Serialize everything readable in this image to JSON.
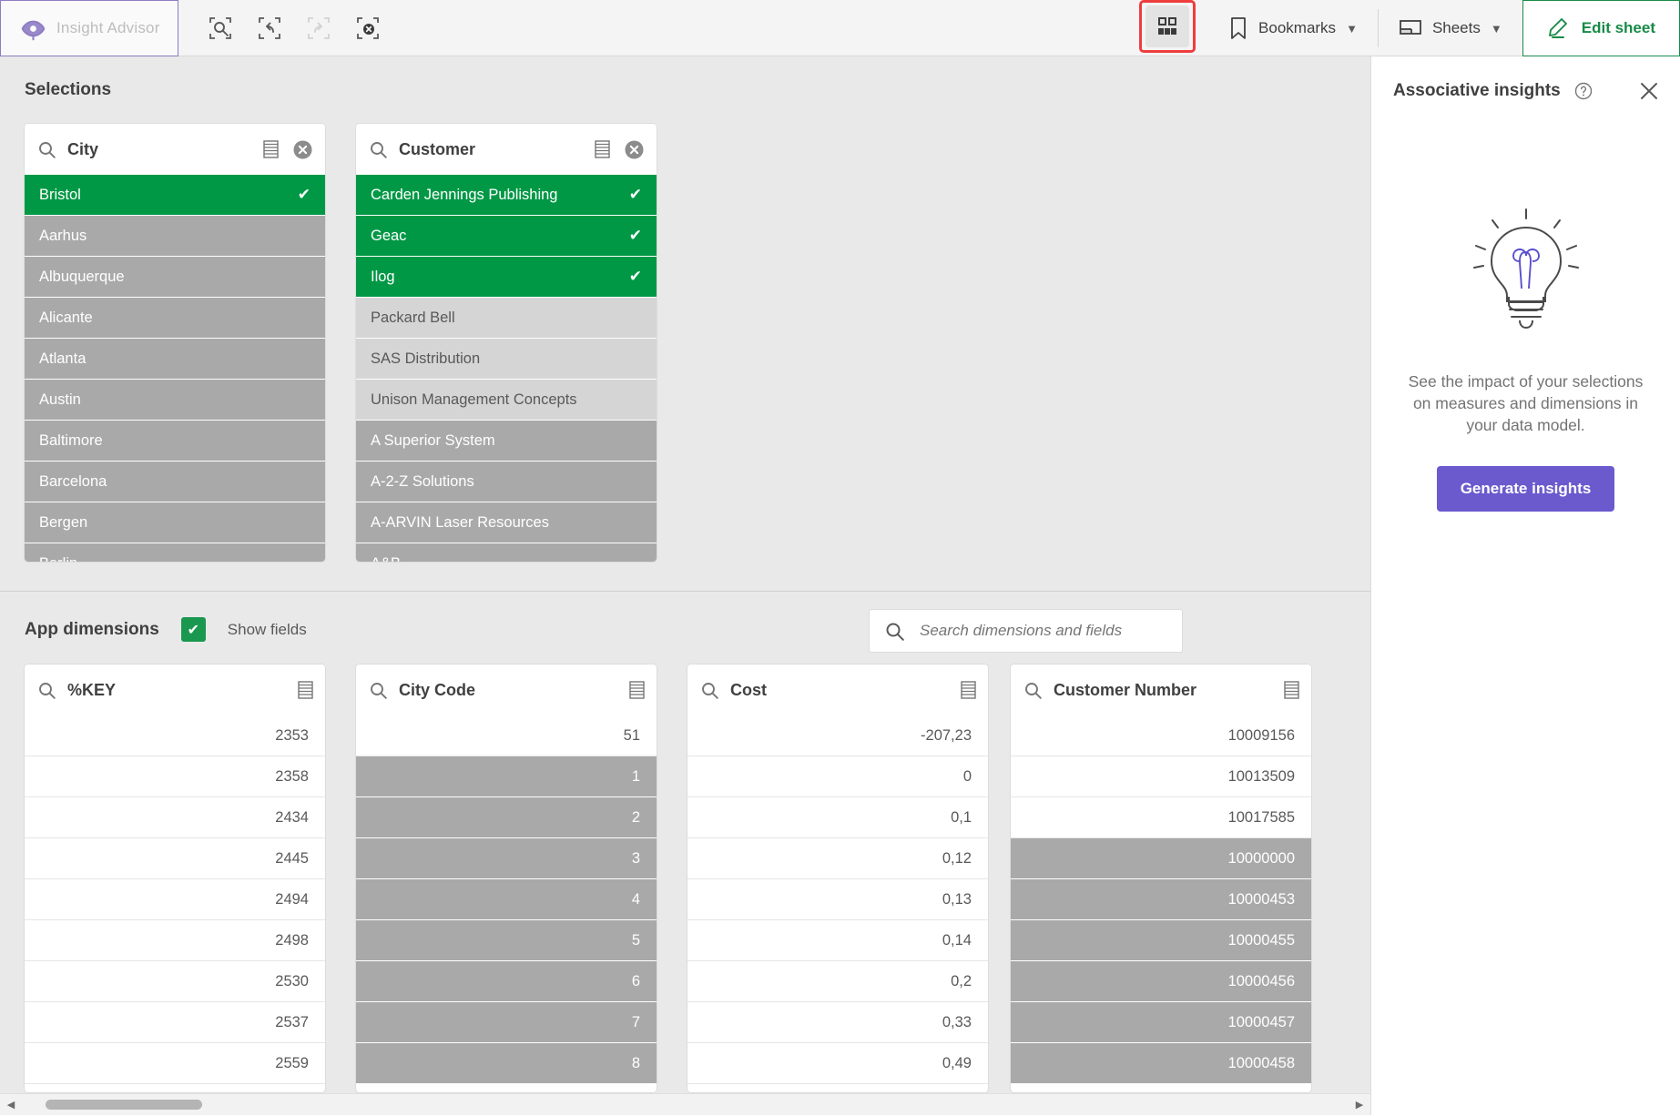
{
  "toolbar": {
    "insight_advisor_label": "Insight Advisor",
    "icons": [
      {
        "name": "smart-search-icon",
        "title": "Smart search"
      },
      {
        "name": "undo-icon",
        "title": "Step back"
      },
      {
        "name": "redo-icon",
        "title": "Step forward"
      },
      {
        "name": "clear-selections-icon",
        "title": "Clear all selections"
      }
    ],
    "selections_tool_label": "Selections tool",
    "bookmarks_label": "Bookmarks",
    "sheets_label": "Sheets",
    "edit_sheet_label": "Edit sheet",
    "highlight_color": "#ef3d3d",
    "accent_green": "#178a46"
  },
  "selections": {
    "title": "Selections",
    "listboxes": [
      {
        "field": "City",
        "clear_title": "Clear selection",
        "items": [
          {
            "label": "Bristol",
            "state": "selected"
          },
          {
            "label": "Aarhus",
            "state": "excluded"
          },
          {
            "label": "Albuquerque",
            "state": "excluded"
          },
          {
            "label": "Alicante",
            "state": "excluded"
          },
          {
            "label": "Atlanta",
            "state": "excluded"
          },
          {
            "label": "Austin",
            "state": "excluded"
          },
          {
            "label": "Baltimore",
            "state": "excluded"
          },
          {
            "label": "Barcelona",
            "state": "excluded"
          },
          {
            "label": "Bergen",
            "state": "excluded"
          },
          {
            "label": "Berlin",
            "state": "excluded"
          }
        ]
      },
      {
        "field": "Customer",
        "clear_title": "Clear selection",
        "items": [
          {
            "label": "Carden Jennings Publishing",
            "state": "selected"
          },
          {
            "label": "Geac",
            "state": "selected"
          },
          {
            "label": "Ilog",
            "state": "selected"
          },
          {
            "label": "Packard Bell",
            "state": "alternative"
          },
          {
            "label": "SAS Distribution",
            "state": "alternative"
          },
          {
            "label": "Unison Management Concepts",
            "state": "alternative"
          },
          {
            "label": "A Superior System",
            "state": "excluded"
          },
          {
            "label": "A-2-Z Solutions",
            "state": "excluded"
          },
          {
            "label": "A-ARVIN Laser Resources",
            "state": "excluded"
          },
          {
            "label": "A&B",
            "state": "excluded"
          }
        ]
      }
    ]
  },
  "app_dimensions": {
    "title": "App dimensions",
    "show_fields_label": "Show fields",
    "show_fields_checked": true,
    "search_placeholder": "Search dimensions and fields",
    "search_value": "",
    "listboxes": [
      {
        "field": "%KEY",
        "items": [
          {
            "label": "2353",
            "state": "plain"
          },
          {
            "label": "2358",
            "state": "plain"
          },
          {
            "label": "2434",
            "state": "plain"
          },
          {
            "label": "2445",
            "state": "plain"
          },
          {
            "label": "2494",
            "state": "plain"
          },
          {
            "label": "2498",
            "state": "plain"
          },
          {
            "label": "2530",
            "state": "plain"
          },
          {
            "label": "2537",
            "state": "plain"
          },
          {
            "label": "2559",
            "state": "plain"
          }
        ]
      },
      {
        "field": "City Code",
        "items": [
          {
            "label": "51",
            "state": "plain"
          },
          {
            "label": "1",
            "state": "excluded"
          },
          {
            "label": "2",
            "state": "excluded"
          },
          {
            "label": "3",
            "state": "excluded"
          },
          {
            "label": "4",
            "state": "excluded"
          },
          {
            "label": "5",
            "state": "excluded"
          },
          {
            "label": "6",
            "state": "excluded"
          },
          {
            "label": "7",
            "state": "excluded"
          },
          {
            "label": "8",
            "state": "excluded"
          }
        ]
      },
      {
        "field": "Cost",
        "items": [
          {
            "label": "-207,23",
            "state": "plain"
          },
          {
            "label": "0",
            "state": "plain"
          },
          {
            "label": "0,1",
            "state": "plain"
          },
          {
            "label": "0,12",
            "state": "plain"
          },
          {
            "label": "0,13",
            "state": "plain"
          },
          {
            "label": "0,14",
            "state": "plain"
          },
          {
            "label": "0,2",
            "state": "plain"
          },
          {
            "label": "0,33",
            "state": "plain"
          },
          {
            "label": "0,49",
            "state": "plain"
          }
        ]
      },
      {
        "field": "Customer Number",
        "items": [
          {
            "label": "10009156",
            "state": "plain"
          },
          {
            "label": "10013509",
            "state": "plain"
          },
          {
            "label": "10017585",
            "state": "plain"
          },
          {
            "label": "10000000",
            "state": "excluded"
          },
          {
            "label": "10000453",
            "state": "excluded"
          },
          {
            "label": "10000455",
            "state": "excluded"
          },
          {
            "label": "10000456",
            "state": "excluded"
          },
          {
            "label": "10000457",
            "state": "excluded"
          },
          {
            "label": "10000458",
            "state": "excluded"
          }
        ]
      }
    ]
  },
  "associative_insights": {
    "title": "Associative insights",
    "help_title": "Help",
    "close_title": "Close",
    "description": "See the impact of your selections on measures and dimensions in your data model.",
    "generate_label": "Generate insights",
    "button_color": "#6a5acd"
  },
  "state_colors": {
    "selected": "#009845",
    "alternative": "#d5d5d5",
    "excluded": "#a9a9a9",
    "plain": "#ffffff"
  }
}
